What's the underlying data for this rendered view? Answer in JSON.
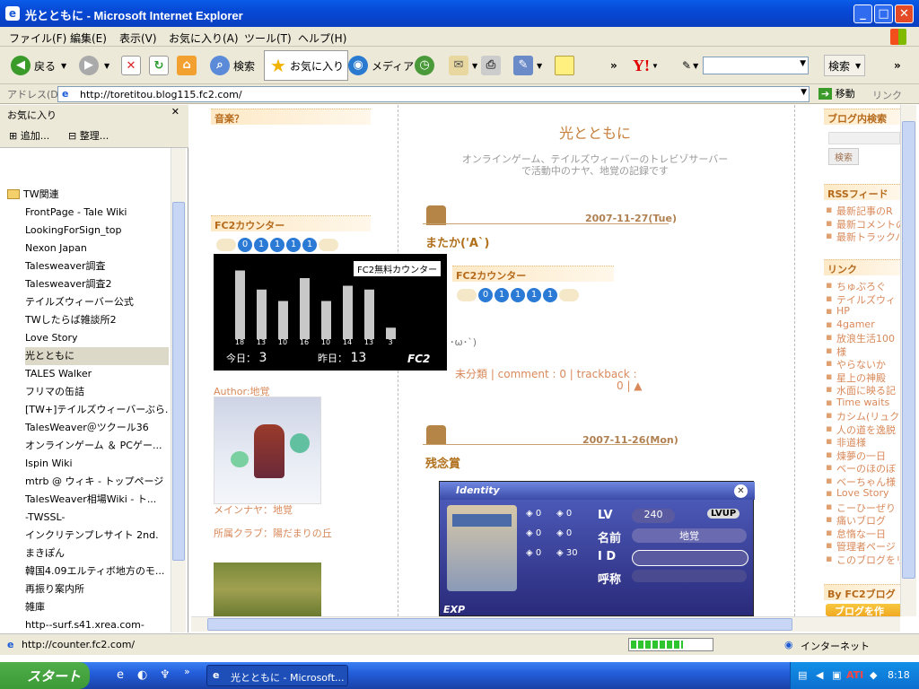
{
  "window": {
    "title": "光とともに - Microsoft Internet Explorer",
    "min": "_",
    "max": "□",
    "close": "✕"
  },
  "menu": [
    "ファイル(F)",
    "編集(E)",
    "表示(V)",
    "お気に入り(A)",
    "ツール(T)",
    "ヘルプ(H)"
  ],
  "toolbar": {
    "back": "戻る",
    "search": "検索",
    "favorites": "お気に入り",
    "media": "メディア",
    "yahoo": "Y!",
    "yahoo_search": "検索"
  },
  "address": {
    "label": "アドレス(D)",
    "url": "http://toretitou.blog115.fc2.com/",
    "go": "移動",
    "links": "リンク"
  },
  "favorites": {
    "title": "お気に入り",
    "add": "追加...",
    "organize": "整理...",
    "folder": "TW関連",
    "items": [
      "FrontPage - Tale Wiki",
      "LookingForSign_top",
      "Nexon Japan",
      "Talesweaver調査",
      "Talesweaver調査2",
      "テイルズウィーバー公式",
      "TWしたらば雑談所2",
      "Love Story",
      "光とともに",
      "TALES Walker",
      "フリマの缶詰",
      "[TW+]テイルズウィーバーぶら...",
      "TalesWeaver＠ツクール36",
      "オンラインゲーム ＆ PCゲー...",
      "Ispin Wiki",
      "mtrb @ ウィキ - トップページ",
      "TalesWeaver相場Wiki - ト...",
      "-TWSSL-",
      "インクリテンプレサイト 2nd.",
      "まきぽん",
      "韓国4.09エルティボ地方のモ...",
      "再振り案内所",
      "雑庫",
      "http--surf.s41.xrea.com-"
    ]
  },
  "left": {
    "music": "音楽？",
    "counter": "FC2カウンター",
    "digits": "01111",
    "popup_title": "FC2無料カウンター",
    "bars": [
      18,
      13,
      10,
      16,
      10,
      14,
      13,
      3
    ],
    "today_label": "今日：",
    "today": "3",
    "yesterday_label": "昨日：",
    "yesterday": "13",
    "fc2": "FC2",
    "author": "Author:地覚",
    "main": "メインナヤ：地覚",
    "club": "所属クラブ：陽だまりの丘"
  },
  "center": {
    "blog_title": "光とともに",
    "desc1": "オンラインゲーム、テイルズウィーバーのトレビゾサーバー",
    "desc2": "で活動中のナヤ、地覚の記録です",
    "post1_date": "2007-11-27(Tue)",
    "post1_title": "またか('A`)",
    "post1_body": "･ω･`)",
    "post1_foot": "未分類 |  comment : 0 |  trackback :",
    "post1_foot2": "0 |  ▲",
    "counter2": "FC2カウンター",
    "post2_date": "2007-11-26(Mon)",
    "post2_title": "残念賞",
    "game": {
      "title": "Identity",
      "lv_label": "LV",
      "lv": "240",
      "lvup": "LVUP",
      "name_label": "名前",
      "name": "地覚",
      "id_label": "I D",
      "call_label": "呼称",
      "exp": "EXP",
      "nums": [
        "0",
        "0",
        "0",
        "0",
        "0",
        "30"
      ]
    }
  },
  "right": {
    "search_head": "ブログ内検索",
    "search_btn": "検索",
    "rss_head": "RSSフィード",
    "rss": [
      "最新記事のR",
      "最新コメントの",
      "最新トラックバ"
    ],
    "links_head": "リンク",
    "links": [
      "ちゅぷろぐ",
      "テイルズウィ",
      "HP",
      "4gamer",
      "放浪生活100",
      "様",
      "やらないか",
      "星上の神殿",
      "水面に映る記",
      "Time waits",
      "カシム(リュク",
      "人の道を逸脱",
      "非道様",
      "煉夢の一日",
      "ベーのほのぼ",
      "ベーちゃん様",
      "Love Story",
      "こーひーぜり",
      "痛いブログ",
      "怠惰な一日",
      "管理者ページ",
      "このブログをリン"
    ],
    "fc2_head": "By FC2ブログ",
    "fc2_btn": "ブログを作る"
  },
  "status": {
    "url": "http://counter.fc2.com/",
    "zone": "インターネット"
  },
  "taskbar": {
    "start": "スタート",
    "task": "光とともに - Microsoft...",
    "time": "8:18"
  }
}
